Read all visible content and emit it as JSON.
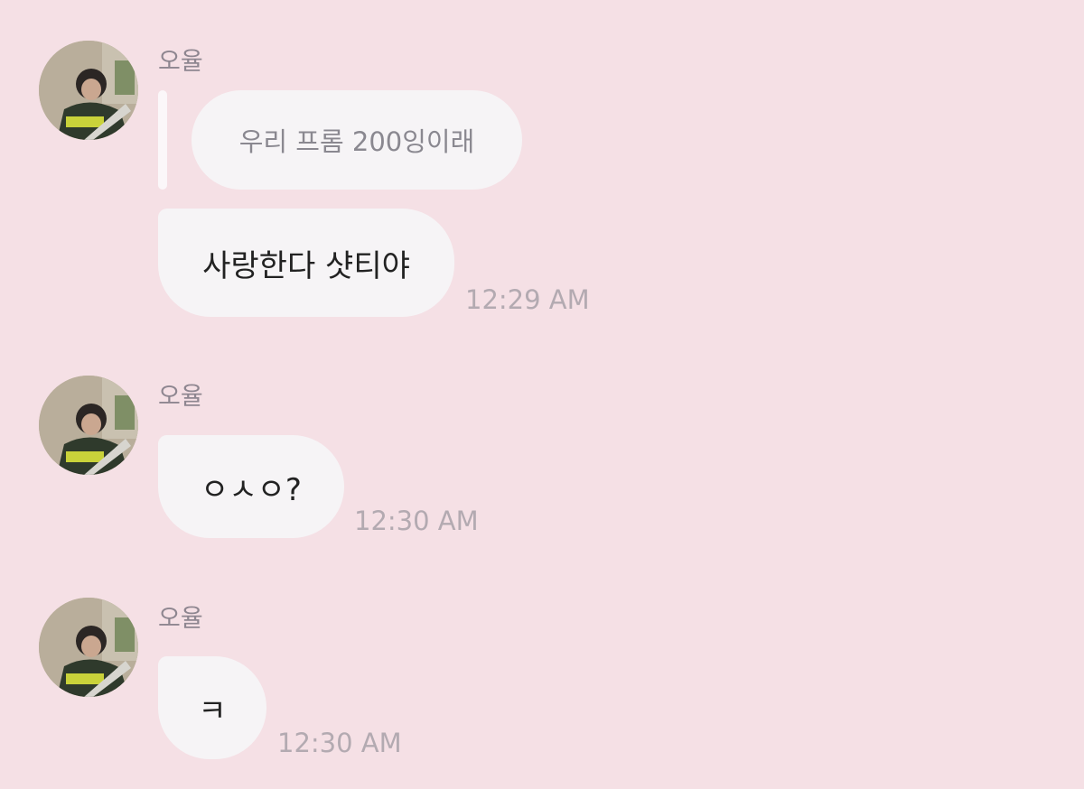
{
  "messages": [
    {
      "sender": "오율",
      "reply_to": "우리 프롬 200잉이래",
      "text": "사랑한다 샷티야",
      "time": "12:29 AM"
    },
    {
      "sender": "오율",
      "text": "ㅇㅅㅇ?",
      "time": "12:30 AM"
    },
    {
      "sender": "오율",
      "text": "ㅋ",
      "time": "12:30 AM"
    }
  ],
  "colors": {
    "background": "#f5e0e5",
    "bubble": "#f6f4f6",
    "timestamp": "#b3aab1",
    "sender": "#8e8690"
  }
}
